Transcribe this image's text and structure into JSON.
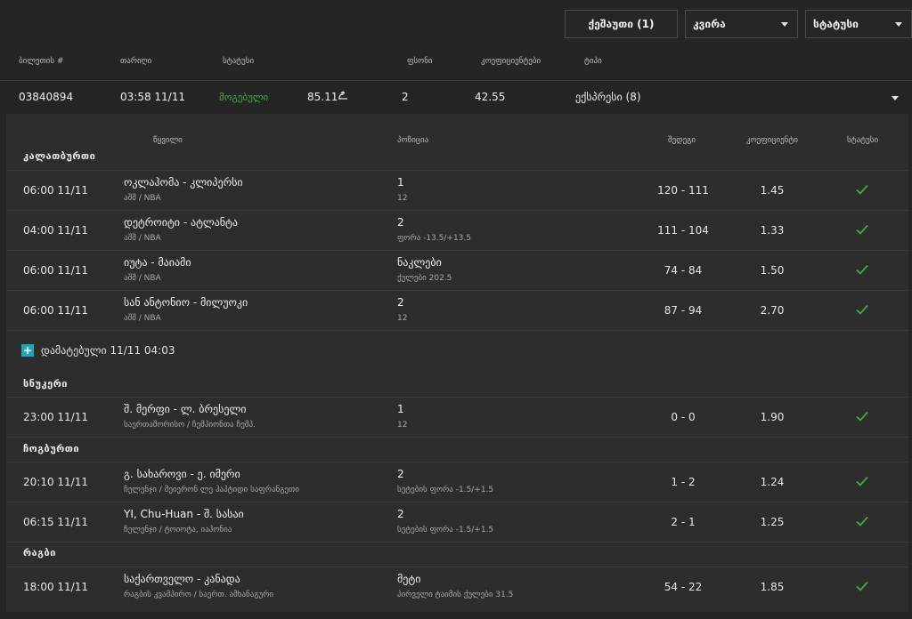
{
  "filters": {
    "basket_label": "ქეშაუთი (1)",
    "period_label": "კვირა",
    "status_label": "სტატუსი"
  },
  "ticket_headers": [
    "ბილეთის #",
    "თარიღი",
    "სტატუსი",
    "ფსონი",
    "კოეფიციენტები",
    "ტიპი"
  ],
  "ticket": {
    "id": "03840894",
    "date": "03:58 11/11",
    "status": "მოგებული",
    "status_color": "#3fae3f",
    "stake": "85.11",
    "bets_count": "2",
    "odds": "42.55",
    "type": "ექსპრესი (8)"
  },
  "detail_headers": {
    "event": "წყვილი",
    "position": "პოზიცია",
    "score": "შედეგი",
    "odds": "კოეფიციენტი",
    "status": "სტატუსი"
  },
  "sports": {
    "basketball": "კალათბურთი",
    "snooker": "სნუკერი",
    "tabletennis": "ჩოგბურთი",
    "rugby": "რაგბი"
  },
  "added": {
    "icon": "plus-icon",
    "label": "დამატებული 11/11 04:03"
  },
  "rows": [
    {
      "time": "06:00 11/11",
      "match": "ოკლაჰომა - კლიპერსი",
      "league": "აშშ / NBA",
      "pick": "1",
      "pick_detail": "12",
      "score": "120 - 111",
      "odds": "1.45"
    },
    {
      "time": "04:00 11/11",
      "match": "დეტროიტი - ატლანტა",
      "league": "აშშ / NBA",
      "pick": "2",
      "pick_detail": "ფორა -13.5/+13.5",
      "score": "111 - 104",
      "odds": "1.33"
    },
    {
      "time": "06:00 11/11",
      "match": "იუტა - მაიამი",
      "league": "აშშ / NBA",
      "pick": "ნაკლები",
      "pick_detail": "ქულები 202.5",
      "score": "74 - 84",
      "odds": "1.50"
    },
    {
      "time": "06:00 11/11",
      "match": "სან ანტონიო - მილუოკი",
      "league": "აშშ / NBA",
      "pick": "2",
      "pick_detail": "12",
      "score": "87 - 94",
      "odds": "2.70"
    },
    {
      "time": "23:00 11/11",
      "match": "შ. მერფი - ლ. ბრესელი",
      "league": "საერთაშორისო / ჩემპიონთა ჩემპ.",
      "pick": "1",
      "pick_detail": "12",
      "score": "0 - 0",
      "odds": "1.90"
    },
    {
      "time": "20:10 11/11",
      "match": "გ. სახაროვი - ე. იმერი",
      "league": "ჩელენჯი / მეიერონ ლე ჰაპტიდი საფრანგეთი",
      "pick": "2",
      "pick_detail": "სეტების ფორა -1.5/+1.5",
      "score": "1 - 2",
      "odds": "1.24"
    },
    {
      "time": "06:15 11/11",
      "match": "YI, Chu-Huan - შ. სასაი",
      "league": "ჩელენჯი / ტოიოტა, იაპონია",
      "pick": "2",
      "pick_detail": "სეტების ფორა -1.5/+1.5",
      "score": "2 - 1",
      "odds": "1.25"
    },
    {
      "time": "18:00 11/11",
      "match": "საქართველო - კანადა",
      "league": "რაგბის კვამპირო / საერთ. ამხანაგური",
      "pick": "მეტი",
      "pick_detail": "პირველი ტაიმის ქულები 31.5",
      "score": "54 - 22",
      "odds": "1.85"
    }
  ]
}
